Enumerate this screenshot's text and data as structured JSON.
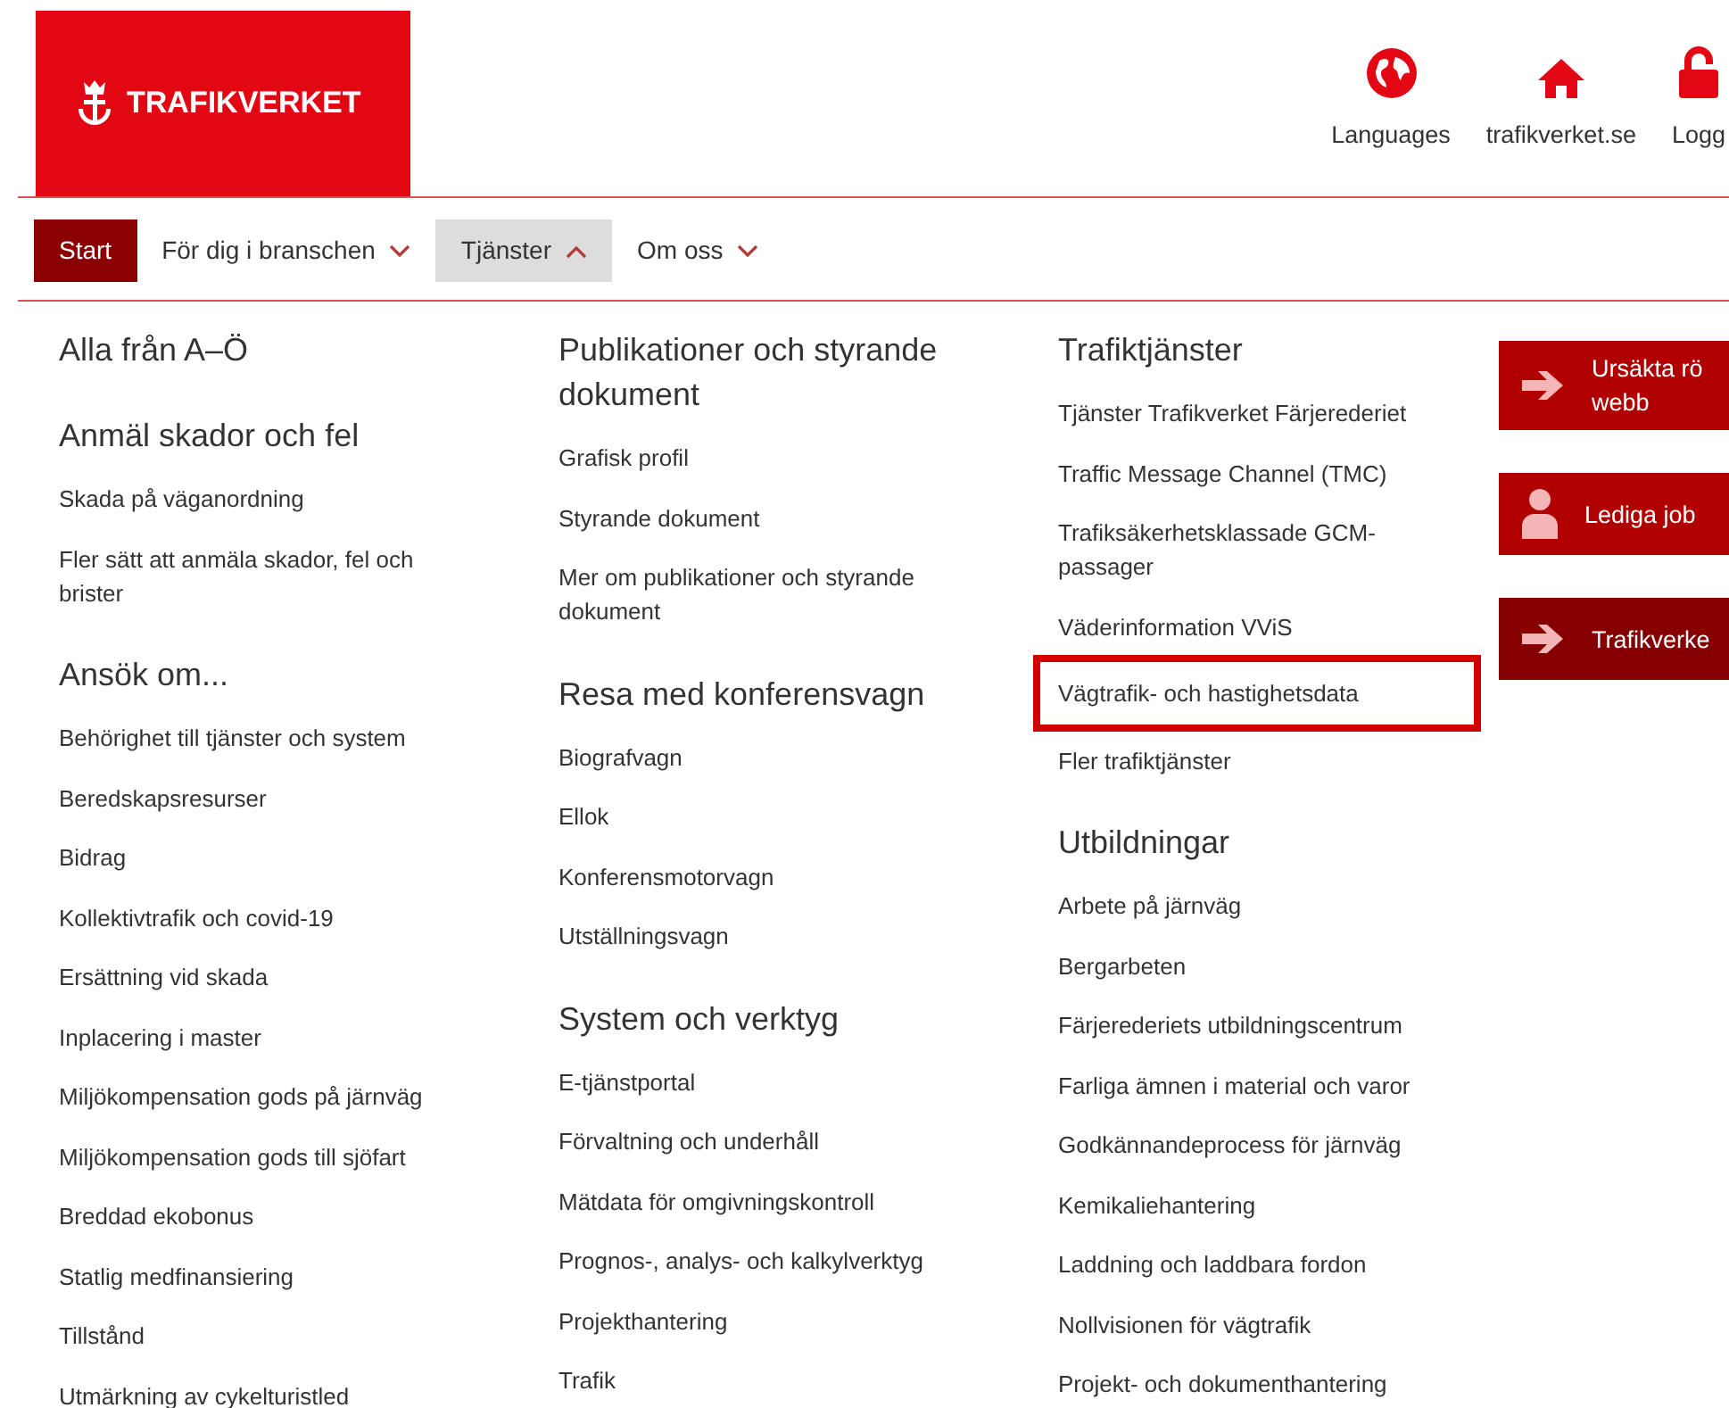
{
  "logo": {
    "text": "TRAFIKVERKET"
  },
  "header_links": [
    {
      "kind": "globe",
      "label": "Languages"
    },
    {
      "kind": "home",
      "label": "trafikverket.se"
    },
    {
      "kind": "lock",
      "label": "Logg"
    }
  ],
  "nav": [
    {
      "label": "Start",
      "selected": true,
      "dropdown": false,
      "expanded": false
    },
    {
      "label": "För dig i branschen",
      "selected": false,
      "dropdown": true,
      "expanded": false
    },
    {
      "label": "Tjänster",
      "selected": false,
      "dropdown": true,
      "expanded": true
    },
    {
      "label": "Om oss",
      "selected": false,
      "dropdown": true,
      "expanded": false
    }
  ],
  "columns": [
    {
      "sections": [
        {
          "heading": "Alla från A–Ö"
        },
        {
          "heading": "Anmäl skador och fel",
          "links": [
            {
              "text": "Skada på väganordning",
              "highlighted": false
            },
            {
              "text": "Fler sätt att anmäla skador, fel och brister",
              "highlighted": false
            }
          ]
        },
        {
          "heading": "Ansök om...",
          "links": [
            {
              "text": "Behörighet till tjänster och system",
              "highlighted": false
            },
            {
              "text": "Beredskapsresurser",
              "highlighted": false
            },
            {
              "text": "Bidrag",
              "highlighted": false
            },
            {
              "text": "Kollektivtrafik och covid-19",
              "highlighted": false
            },
            {
              "text": "Ersättning vid skada",
              "highlighted": false
            },
            {
              "text": "Inplacering i master",
              "highlighted": false
            },
            {
              "text": "Miljökompensation gods på järnväg",
              "highlighted": false
            },
            {
              "text": "Miljökompensation gods till sjöfart",
              "highlighted": false
            },
            {
              "text": "Breddad ekobonus",
              "highlighted": false
            },
            {
              "text": "Statlig medfinansiering",
              "highlighted": false
            },
            {
              "text": "Tillstånd",
              "highlighted": false
            },
            {
              "text": "Utmärkning av cykelturistled",
              "highlighted": false
            }
          ]
        }
      ]
    },
    {
      "sections": [
        {
          "heading": "Publikationer och styrande dokument",
          "links": [
            {
              "text": "Grafisk profil",
              "highlighted": false
            },
            {
              "text": "Styrande dokument",
              "highlighted": false
            },
            {
              "text": "Mer om publikationer och styrande dokument",
              "highlighted": false
            }
          ]
        },
        {
          "heading": "Resa med konferensvagn",
          "links": [
            {
              "text": "Biografvagn",
              "highlighted": false
            },
            {
              "text": "Ellok",
              "highlighted": false
            },
            {
              "text": "Konferensmotorvagn",
              "highlighted": false
            },
            {
              "text": "Utställningsvagn",
              "highlighted": false
            }
          ]
        },
        {
          "heading": "System och verktyg",
          "links": [
            {
              "text": "E-tjänstportal",
              "highlighted": false
            },
            {
              "text": "Förvaltning och underhåll",
              "highlighted": false
            },
            {
              "text": "Mätdata för omgivningskontroll",
              "highlighted": false
            },
            {
              "text": "Prognos-, analys- och kalkylverktyg",
              "highlighted": false
            },
            {
              "text": "Projekthantering",
              "highlighted": false
            },
            {
              "text": "Trafik",
              "highlighted": false
            }
          ]
        }
      ]
    },
    {
      "sections": [
        {
          "heading": "Trafiktjänster",
          "links": [
            {
              "text": "Tjänster Trafikverket Färjerederiet",
              "highlighted": false
            },
            {
              "text": "Traffic Message Channel (TMC)",
              "highlighted": false
            },
            {
              "text": "Trafiksäkerhetsklassade GCM-passager",
              "highlighted": false
            },
            {
              "text": "Väderinformation VViS",
              "highlighted": false
            },
            {
              "text": "Vägtrafik- och hastighetsdata",
              "highlighted": true
            },
            {
              "text": "Fler trafiktjänster",
              "highlighted": false
            }
          ]
        },
        {
          "heading": "Utbildningar",
          "links": [
            {
              "text": "Arbete på järnväg",
              "highlighted": false
            },
            {
              "text": "Bergarbeten",
              "highlighted": false
            },
            {
              "text": "Färjerederiets utbildningscentrum",
              "highlighted": false
            },
            {
              "text": "Farliga ämnen i material och varor",
              "highlighted": false
            },
            {
              "text": "Godkännandeprocess för järnväg",
              "highlighted": false
            },
            {
              "text": "Kemikaliehantering",
              "highlighted": false
            },
            {
              "text": "Laddning och laddbara fordon",
              "highlighted": false
            },
            {
              "text": "Nollvisionen för vägtrafik",
              "highlighted": false
            },
            {
              "text": "Projekt- och dokumenthantering",
              "highlighted": false
            }
          ]
        }
      ]
    }
  ],
  "cards": [
    {
      "kind": "arrow",
      "color": "#b00000",
      "lines": [
        "Ursäkta rö",
        "webb"
      ]
    },
    {
      "kind": "person",
      "color": "#b00000",
      "lines": [
        "Lediga job"
      ]
    },
    {
      "kind": "arrow",
      "color": "#870000",
      "lines": [
        "Trafikverke"
      ]
    }
  ]
}
